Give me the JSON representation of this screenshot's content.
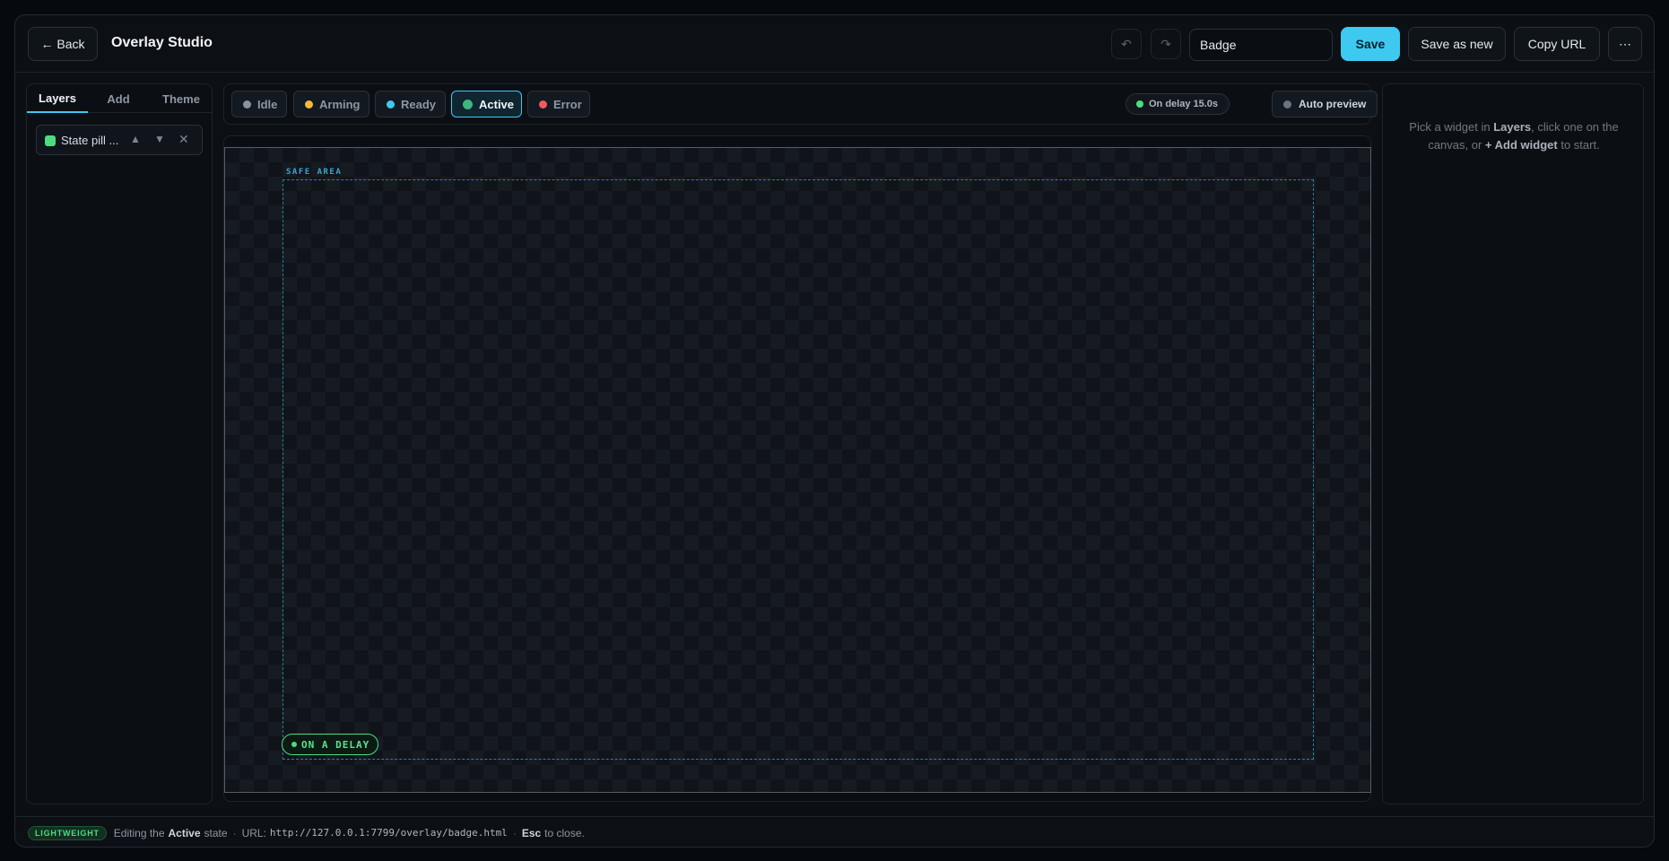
{
  "header": {
    "back_label": "← Back",
    "title": "Overlay Studio",
    "undo_icon": "undo-icon",
    "redo_icon": "redo-icon",
    "name_value": "Badge",
    "save_label": "Save",
    "save_as_new_label": "Save as new",
    "copy_url_label": "Copy URL",
    "more_label": "⋯"
  },
  "left_panel": {
    "tabs": [
      {
        "label": "Layers",
        "active": true
      },
      {
        "label": "Add",
        "active": false
      },
      {
        "label": "Theme",
        "active": false
      }
    ],
    "layers": [
      {
        "label": "State pill ...",
        "color": "#4ade80"
      }
    ]
  },
  "state_bar": {
    "states": [
      {
        "label": "Idle",
        "color": "#8b929c"
      },
      {
        "label": "Arming",
        "color": "#f5b83d"
      },
      {
        "label": "Ready",
        "color": "#3ec9f0"
      },
      {
        "label": "Active",
        "color": "#3fb57d",
        "active": true
      },
      {
        "label": "Error",
        "color": "#f05a5a"
      }
    ],
    "delay_label": "On delay 15.0s",
    "auto_preview_label": "Auto preview"
  },
  "canvas": {
    "safe_area_label": "SAFE AREA",
    "pill_label": "ON A DELAY"
  },
  "right_panel": {
    "hint_pre": "Pick a widget in",
    "hint_layers": "Layers",
    "hint_mid": ", click one on the canvas, or",
    "hint_add": "+ Add widget",
    "hint_post": "to start."
  },
  "footer": {
    "badge": "LIGHTWEIGHT",
    "editing_pre": "Editing the",
    "editing_state": "Active",
    "editing_post": "state",
    "url_label": "URL:",
    "url_value": "http://127.0.0.1:7799/overlay/badge.html",
    "esc_key": "Esc",
    "esc_post": "to close."
  },
  "colors": {
    "accent": "#3ec9f0",
    "success": "#4ade80"
  }
}
